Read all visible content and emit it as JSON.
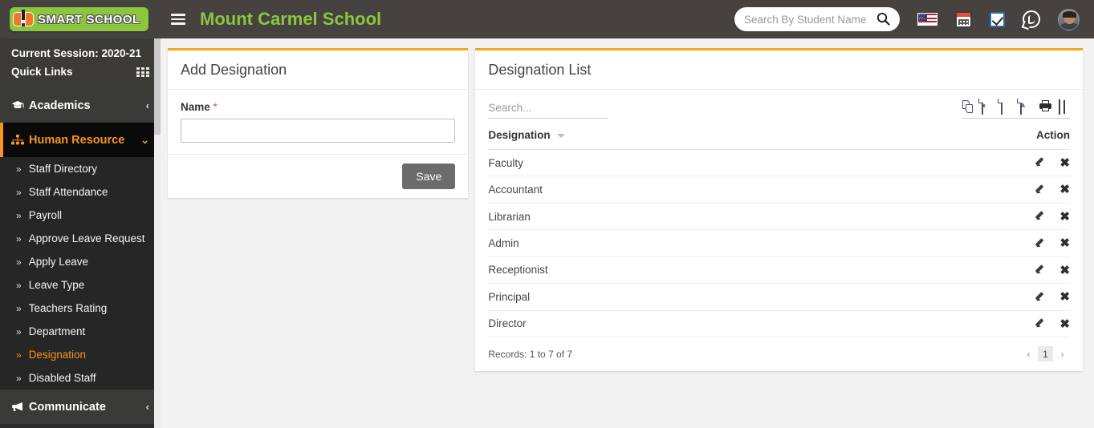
{
  "brand": {
    "logo_text": "SMART SCHOOL",
    "accent_orange": "#F7941E",
    "accent_green": "#8CC63E",
    "card_accent": "#F5A623"
  },
  "header": {
    "hamburger": "menu-icon",
    "school_title": "Mount Carmel School",
    "search": {
      "placeholder": "Search By Student Name",
      "value": ""
    },
    "icons": [
      {
        "name": "flag-icon",
        "label": "English (US)"
      },
      {
        "name": "calendar-icon",
        "label": "Calendar"
      },
      {
        "name": "checkbox-icon",
        "label": "Tasks"
      },
      {
        "name": "whatsapp-icon",
        "label": "WhatsApp"
      },
      {
        "name": "avatar",
        "label": "Profile"
      }
    ]
  },
  "sidebar": {
    "session_label": "Current Session: 2020-21",
    "quick_links_label": "Quick Links",
    "quick_links_icon": "grid-icon",
    "groups": [
      {
        "label": "Academics",
        "icon": "graduation-cap-icon",
        "chevron": "‹",
        "active": false
      },
      {
        "label": "Human Resource",
        "icon": "sitemap-icon",
        "chevron": "⌄",
        "active": true
      }
    ],
    "sub_items": [
      {
        "label": "Staff Directory",
        "active": false
      },
      {
        "label": "Staff Attendance",
        "active": false
      },
      {
        "label": "Payroll",
        "active": false
      },
      {
        "label": "Approve Leave Request",
        "active": false
      },
      {
        "label": "Apply Leave",
        "active": false
      },
      {
        "label": "Leave Type",
        "active": false
      },
      {
        "label": "Teachers Rating",
        "active": false
      },
      {
        "label": "Department",
        "active": false
      },
      {
        "label": "Designation",
        "active": true
      },
      {
        "label": "Disabled Staff",
        "active": false
      }
    ],
    "bottom_group": {
      "label": "Communicate",
      "icon": "bullhorn-icon",
      "chevron": "‹"
    },
    "sub_arrow": "»"
  },
  "add_card": {
    "title": "Add Designation",
    "name_label": "Name",
    "required_mark": "*",
    "name_value": "",
    "name_placeholder": "",
    "save_label": "Save"
  },
  "list_card": {
    "title": "Designation List",
    "search_placeholder": "Search...",
    "search_value": "",
    "export_buttons": [
      {
        "name": "copy-icon",
        "label": "Copy"
      },
      {
        "name": "excel-icon",
        "label": "Excel",
        "glyph": "x"
      },
      {
        "name": "csv-icon",
        "label": "CSV"
      },
      {
        "name": "pdf-icon",
        "label": "PDF",
        "glyph": "A"
      },
      {
        "name": "print-icon",
        "label": "Print"
      },
      {
        "name": "column-visibility-icon",
        "label": "Column visibility"
      }
    ],
    "columns": [
      "Designation",
      "Action"
    ],
    "rows": [
      {
        "designation": "Faculty"
      },
      {
        "designation": "Accountant"
      },
      {
        "designation": "Librarian"
      },
      {
        "designation": "Admin"
      },
      {
        "designation": "Receptionist"
      },
      {
        "designation": "Principal"
      },
      {
        "designation": "Director"
      }
    ],
    "row_actions": {
      "edit": "edit-pencil-icon",
      "delete": "delete-x-icon",
      "delete_glyph": "✖"
    },
    "records_text": "Records: 1 to 7 of 7",
    "pagination": {
      "prev": "‹",
      "next": "›",
      "pages": [
        "1"
      ],
      "current": "1"
    }
  }
}
